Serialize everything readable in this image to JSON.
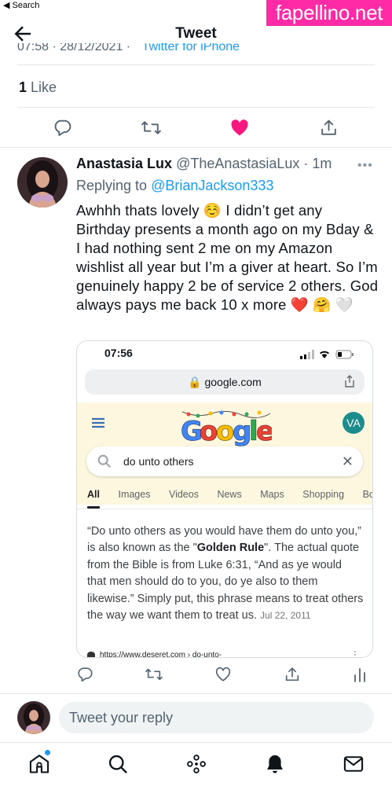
{
  "status_bar": {
    "back_app": "◀ Search"
  },
  "watermark": "fapellino.net",
  "header": {
    "title": "Tweet"
  },
  "cut_meta": {
    "time_date": "07:58 · 28/12/2021 ·",
    "source": "Twitter for iPhone"
  },
  "likes": {
    "count": "1",
    "label": "Like"
  },
  "reply_tweet": {
    "name": "Anastasia Lux",
    "handle": "@TheAnastasiaLux",
    "time": " · 1m",
    "more": "•••",
    "replying_prefix": "Replying to ",
    "replying_to": "@BrianJackson333",
    "text": "Awhhh thats lovely ☺️ I didn’t get any Birthday presents a month ago on my Bday & I had nothing sent 2 me on my Amazon wishlist all year but I’m a giver at heart. So I’m genuinely happy 2 be of service 2 others. God always pays me back 10 x more ❤️ 🤗 🤍"
  },
  "screenshot": {
    "time": "07:56",
    "url": "🔒 google.com",
    "avatar_initials": "VA",
    "query": "do unto others",
    "tabs": [
      "All",
      "Images",
      "Videos",
      "News",
      "Maps",
      "Shopping",
      "Boo"
    ],
    "snippet_a": "“Do unto others as you would have them do unto you,” is also known as the \"",
    "snippet_bold": "Golden Rule",
    "snippet_b": "\". The actual quote from the Bible is from Luke 6:31, “And as ye would that men should do to you, do ye also to them likewise.” Simply put, this phrase means to treat others the way we want them to treat us.",
    "snippet_date": "Jul 22, 2011",
    "cite": "https://www.deseret.com › do-unto-"
  },
  "reply_box": {
    "placeholder": "Tweet your reply"
  },
  "colors": {
    "accent": "#1d9bf0",
    "like": "#f91880",
    "watermark": "#ff2aa6"
  }
}
